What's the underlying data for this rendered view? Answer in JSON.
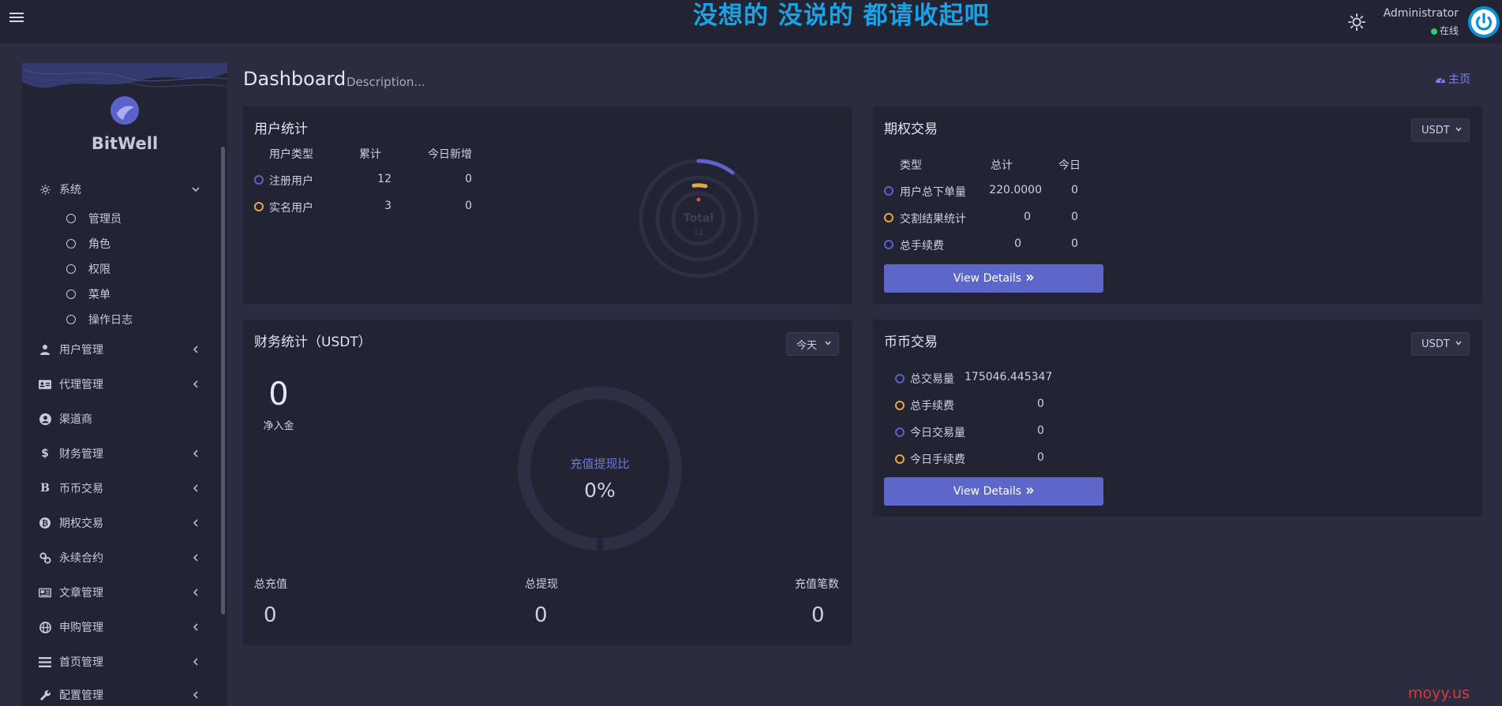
{
  "header": {
    "marquee": "没想的 没说的 都请收起吧",
    "user_name": "Administrator",
    "user_status": "在线"
  },
  "sidebar": {
    "brand": "BitWell",
    "system": {
      "label": "系统",
      "children": [
        "管理员",
        "角色",
        "权限",
        "菜单",
        "操作日志"
      ]
    },
    "items": [
      {
        "label": "用户管理",
        "icon": "user-tie-icon",
        "has_children": true
      },
      {
        "label": "代理管理",
        "icon": "id-card-icon",
        "has_children": true
      },
      {
        "label": "渠道商",
        "icon": "user-circle-icon",
        "has_children": false
      },
      {
        "label": "财务管理",
        "icon": "dollar-icon",
        "has_children": true
      },
      {
        "label": "币币交易",
        "icon": "bitcoin-b-icon",
        "has_children": true
      },
      {
        "label": "期权交易",
        "icon": "bitcoin-icon",
        "has_children": true
      },
      {
        "label": "永续合约",
        "icon": "link-icon",
        "has_children": true
      },
      {
        "label": "文章管理",
        "icon": "newspaper-icon",
        "has_children": true
      },
      {
        "label": "申购管理",
        "icon": "globe-icon",
        "has_children": true
      },
      {
        "label": "首页管理",
        "icon": "list-icon",
        "has_children": true
      },
      {
        "label": "配置管理",
        "icon": "wrench-icon",
        "has_children": true
      }
    ]
  },
  "page": {
    "title": "Dashboard",
    "description": "Description...",
    "home_link": "主页"
  },
  "user_stats": {
    "title": "用户统计",
    "headers": [
      "用户类型",
      "累计",
      "今日新增"
    ],
    "rows": [
      {
        "type": "注册用户",
        "total": "12",
        "today": "0",
        "color": "#5a63c9"
      },
      {
        "type": "实名用户",
        "total": "3",
        "today": "0",
        "color": "#e9a645"
      }
    ],
    "chart_center_label": "Total",
    "chart_center_value": "12"
  },
  "options_trade": {
    "title": "期权交易",
    "select": "USDT",
    "headers": [
      "类型",
      "总计",
      "今日"
    ],
    "rows": [
      {
        "type": "用户总下单量",
        "total": "220.0000",
        "today": "0",
        "color": "#5a63c9"
      },
      {
        "type": "交割结果统计",
        "total": "0",
        "today": "0",
        "color": "#e9a645"
      },
      {
        "type": "总手续费",
        "total": "0",
        "today": "0",
        "color": "#5a63c9"
      }
    ],
    "button": "View Details"
  },
  "finance": {
    "title": "财务统计（USDT）",
    "select": "今天",
    "net_value": "0",
    "net_label": "净入金",
    "ratio_label": "充值提现比",
    "ratio_value": "0%",
    "stats": [
      {
        "label": "总充值",
        "value": "0"
      },
      {
        "label": "总提现",
        "value": "0"
      },
      {
        "label": "充值笔数",
        "value": "0"
      }
    ]
  },
  "coin_trade": {
    "title": "币币交易",
    "select": "USDT",
    "rows": [
      {
        "type": "总交易量",
        "value": "175046.445347",
        "color": "#5a63c9"
      },
      {
        "type": "总手续费",
        "value": "0",
        "color": "#e9a645"
      },
      {
        "type": "今日交易量",
        "value": "0",
        "color": "#5a63c9"
      },
      {
        "type": "今日手续费",
        "value": "0",
        "color": "#e9a645"
      }
    ],
    "button": "View Details"
  },
  "watermark": "moyy.us"
}
